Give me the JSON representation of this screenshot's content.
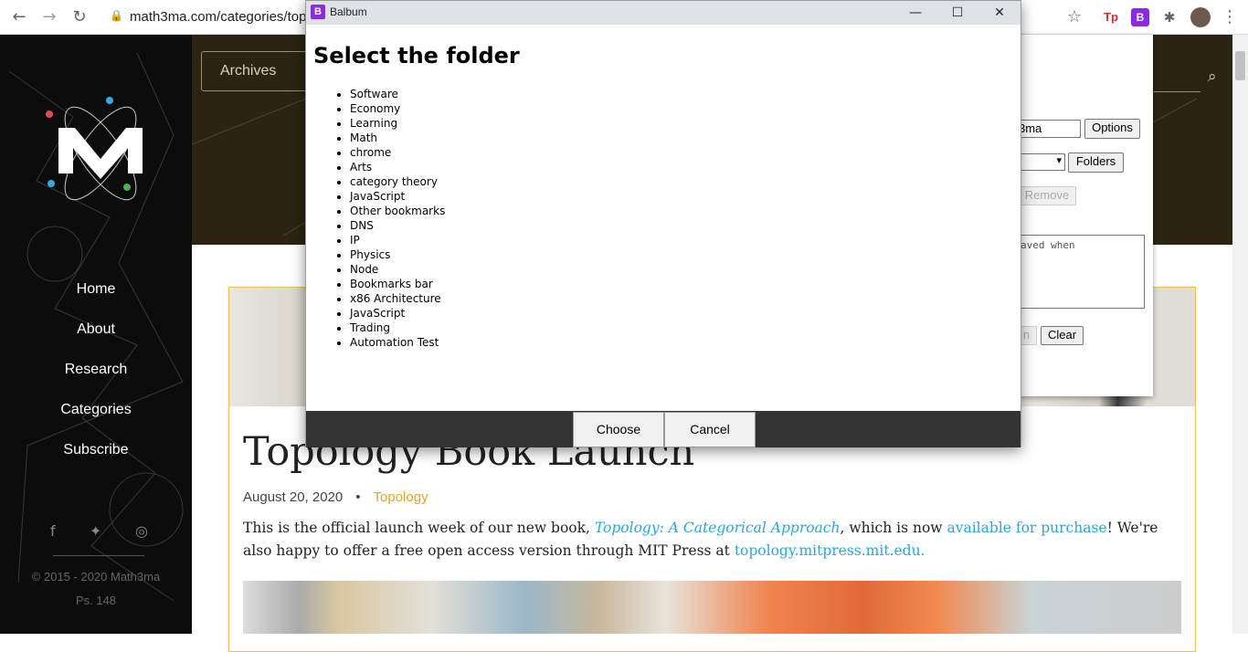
{
  "browser": {
    "url": "math3ma.com/categories/topo",
    "extensions": [
      {
        "name": "tp",
        "label": "Tp",
        "color": "#e3262e"
      },
      {
        "name": "balbum",
        "label": "B",
        "color": "#8a2be2"
      }
    ]
  },
  "sidebar": {
    "nav": [
      "Home",
      "About",
      "Research",
      "Categories",
      "Subscribe"
    ],
    "copyright": "© 2015 - 2020 Math3ma",
    "ps": "Ps. 148"
  },
  "header": {
    "archives": "Archives"
  },
  "article": {
    "title": "Topology Book Launch",
    "date": "August 20, 2020",
    "dot": "•",
    "category": "Topology",
    "body_1": "This is the official launch week of our new book, ",
    "body_link_book": "Topology: A Categorical Approach",
    "body_2": ", which is now ",
    "body_link_purchase": "available for purchase",
    "body_3": "! We're also happy to offer a free open access version through MIT Press at ",
    "body_link_mit": "topology.mitpress.mit.edu."
  },
  "ext_popup": {
    "name_value": "3ma",
    "options_label": "Options",
    "folders_label": "Folders",
    "remove_label": "Remove",
    "textarea_text": "aved when",
    "partial_btn": "n",
    "clear_label": "Clear"
  },
  "dialog": {
    "app_name": "Balbum",
    "app_icon": "B",
    "heading": "Select the folder",
    "folders": [
      "Software",
      "Economy",
      "Learning",
      "Math",
      "chrome",
      "Arts",
      "category theory",
      "JavaScript",
      "Other bookmarks",
      "DNS",
      "IP",
      "Physics",
      "Node",
      "Bookmarks bar",
      "x86 Architecture",
      "JavaScript",
      "Trading",
      "Automation Test"
    ],
    "choose_label": "Choose",
    "cancel_label": "Cancel"
  }
}
